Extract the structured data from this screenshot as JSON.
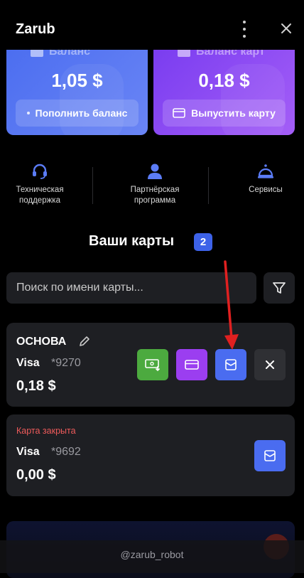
{
  "header": {
    "title": "Zarub"
  },
  "balances": [
    {
      "peek_label": "Баланс",
      "amount": "1,05 $",
      "button": "Пополнить баланс",
      "color": "#5677f2"
    },
    {
      "peek_label": "Баланс карт",
      "amount": "0,18 $",
      "button": "Выпустить карту",
      "color": "#8b4cf5"
    }
  ],
  "quick_actions": [
    {
      "label": "Техническая поддержка",
      "icon": "headset-icon"
    },
    {
      "label": "Партнёрская программа",
      "icon": "user-icon"
    },
    {
      "label": "Сервисы",
      "icon": "service-bell-icon"
    }
  ],
  "cards_section": {
    "title": "Ваши карты",
    "count": "2"
  },
  "search": {
    "placeholder": "Поиск по имени карты..."
  },
  "cards": [
    {
      "name": "ОСНОВА",
      "brand": "Visa",
      "mask": "*9270",
      "balance": "0,18 $",
      "actions": [
        "top-up-icon",
        "card-details-icon",
        "statement-icon",
        "close-icon"
      ],
      "action_colors": [
        "#4caa3f",
        "#9b3ef0",
        "#4a6cf0",
        "#2f3034"
      ]
    },
    {
      "status": "Карта закрыта",
      "brand": "Visa",
      "mask": "*9692",
      "balance": "0,00 $",
      "actions": [
        "statement-icon"
      ]
    }
  ],
  "footer": {
    "handle": "@zarub_robot"
  },
  "colors": {
    "background": "#000000",
    "card_bg": "#1e1f23",
    "accent": "#3d62e8",
    "danger": "#ef5b5b",
    "arrow": "#e02020"
  }
}
